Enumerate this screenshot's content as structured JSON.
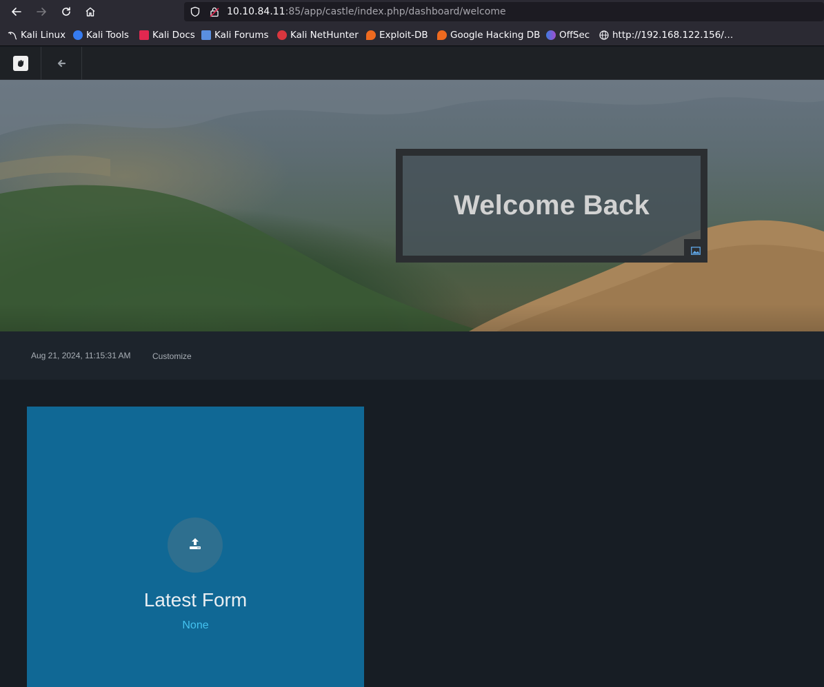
{
  "browser": {
    "url_host": "10.10.84.11",
    "url_rest": ":85/app/castle/index.php/dashboard/welcome",
    "bookmarks": [
      {
        "label": "Kali Linux",
        "icon": "kali-dragon-icon"
      },
      {
        "label": "Kali Tools",
        "icon": "kali-tools-icon"
      },
      {
        "label": "Kali Docs",
        "icon": "kali-docs-icon"
      },
      {
        "label": "Kali Forums",
        "icon": "kali-forums-icon"
      },
      {
        "label": "Kali NetHunter",
        "icon": "kali-nethunter-icon"
      },
      {
        "label": "Exploit-DB",
        "icon": "exploit-db-icon"
      },
      {
        "label": "Google Hacking DB",
        "icon": "ghdb-icon"
      },
      {
        "label": "OffSec",
        "icon": "offsec-icon"
      },
      {
        "label": "http://192.168.122.156/…",
        "icon": "globe-icon"
      }
    ]
  },
  "app": {
    "hero_title": "Welcome Back",
    "timestamp": "Aug 21, 2024, 11:15:31 AM",
    "customize_label": "Customize",
    "card": {
      "title": "Latest Form",
      "value": "None"
    }
  },
  "colors": {
    "browser_chrome": "#2b2a33",
    "app_background": "#171d24",
    "card_background": "#106895",
    "card_value": "#44c2f0"
  }
}
